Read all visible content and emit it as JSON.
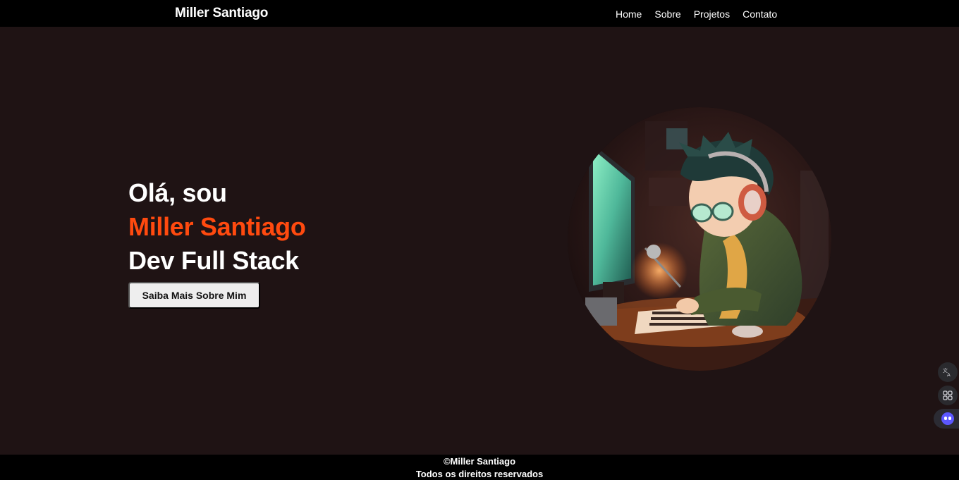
{
  "header": {
    "brand": "Miller Santiago",
    "nav": [
      "Home",
      "Sobre",
      "Projetos",
      "Contato"
    ]
  },
  "hero": {
    "line1": "Olá, sou",
    "line2": "Miller Santiago",
    "line3": "Dev Full Stack",
    "cta": "Saiba Mais Sobre Mim",
    "accent_color": "#ff4a0f",
    "image_icon": "developer-illustration"
  },
  "widgets": [
    "translate-icon",
    "apps-icon",
    "assistant-bot-icon"
  ],
  "footer": {
    "copyright": "©Miller Santiago",
    "rights": "Todos os direitos reservados"
  }
}
